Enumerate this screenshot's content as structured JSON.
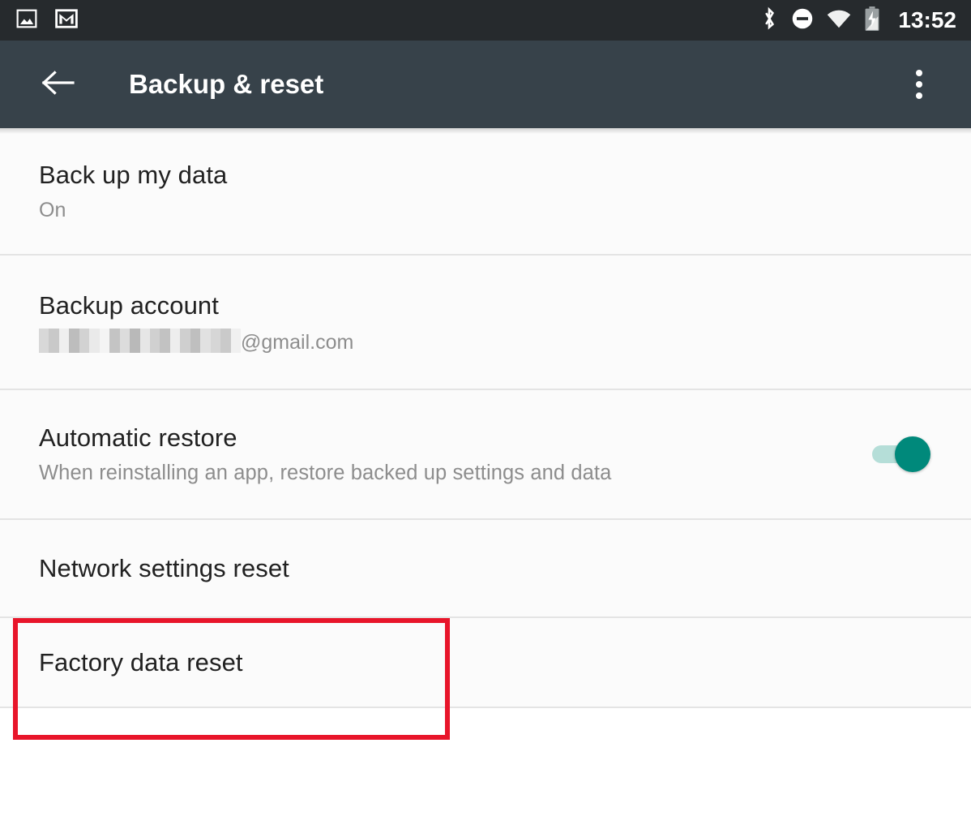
{
  "status_bar": {
    "left_icons": [
      {
        "name": "screenshot-image-icon",
        "glyph": "image"
      },
      {
        "name": "gmail-notification-icon",
        "glyph": "gmail"
      }
    ],
    "right_icons": [
      {
        "name": "bluetooth-icon",
        "glyph": "bluetooth"
      },
      {
        "name": "do-not-disturb-icon",
        "glyph": "minus-circle"
      },
      {
        "name": "wifi-icon",
        "glyph": "wifi"
      },
      {
        "name": "battery-charging-icon",
        "glyph": "battery-bolt"
      }
    ],
    "clock": "13:52",
    "background_color": "#262a2d"
  },
  "app_bar": {
    "back_label": "Back",
    "title": "Backup & reset",
    "overflow_label": "More options",
    "background_color": "#37424a"
  },
  "settings": {
    "items": [
      {
        "title": "Back up my data",
        "subtitle": "On",
        "has_toggle": false
      },
      {
        "title": "Backup account",
        "subtitle_redacted": true,
        "subtitle_domain": "@gmail.com",
        "has_toggle": false
      },
      {
        "title": "Automatic restore",
        "subtitle": "When reinstalling an app, restore backed up settings and data",
        "has_toggle": true,
        "toggle_state": "on"
      },
      {
        "title": "Network settings reset",
        "subtitle": "",
        "has_toggle": false
      },
      {
        "title": "Factory data reset",
        "subtitle": "",
        "has_toggle": false,
        "highlighted": true
      }
    ]
  },
  "annotation": {
    "target": "Factory data reset",
    "color": "#e8152a"
  },
  "colors": {
    "accent_teal": "#00897b",
    "track_teal": "#b5ded8",
    "list_bg": "#fbfbfb",
    "divider": "#e4e4e4",
    "title_text": "#212121",
    "subtitle_text": "#8d8d8d"
  }
}
